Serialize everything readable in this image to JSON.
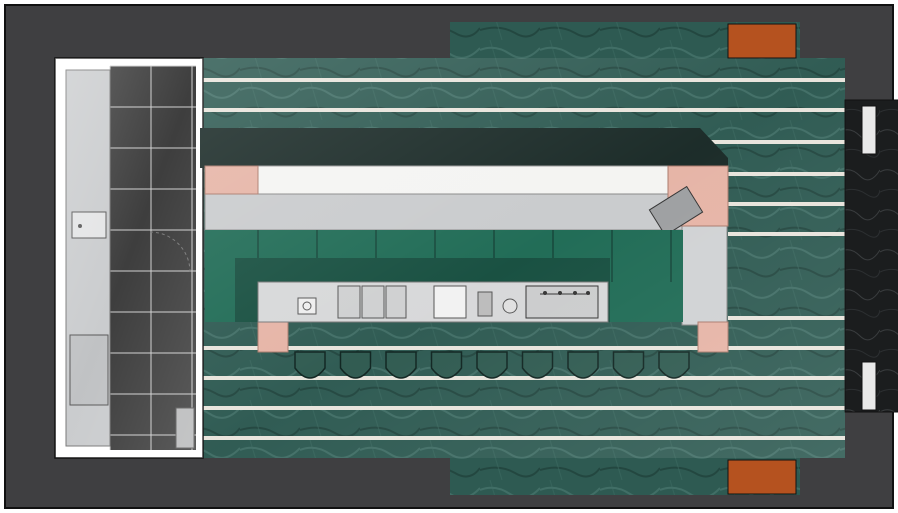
{
  "plan": {
    "colors": {
      "wall": "#3f3f41",
      "frame": "#111111",
      "marble": "#2e5a52",
      "marble_light": "#4f7c73",
      "brass_stripe": "#e8e4dc",
      "booth_green": "#1f6b55",
      "booth_dark": "#174f40",
      "counter_white": "#f4f4f2",
      "steel": "#c9cbcd",
      "copper_pink": "#e6b4a6",
      "wood_panel": "#b5521f",
      "kitchen_tile": "#3a3a3a",
      "stool": "#2f5a50",
      "black_marble": "#1b1d1e"
    },
    "stool_count": 9
  }
}
